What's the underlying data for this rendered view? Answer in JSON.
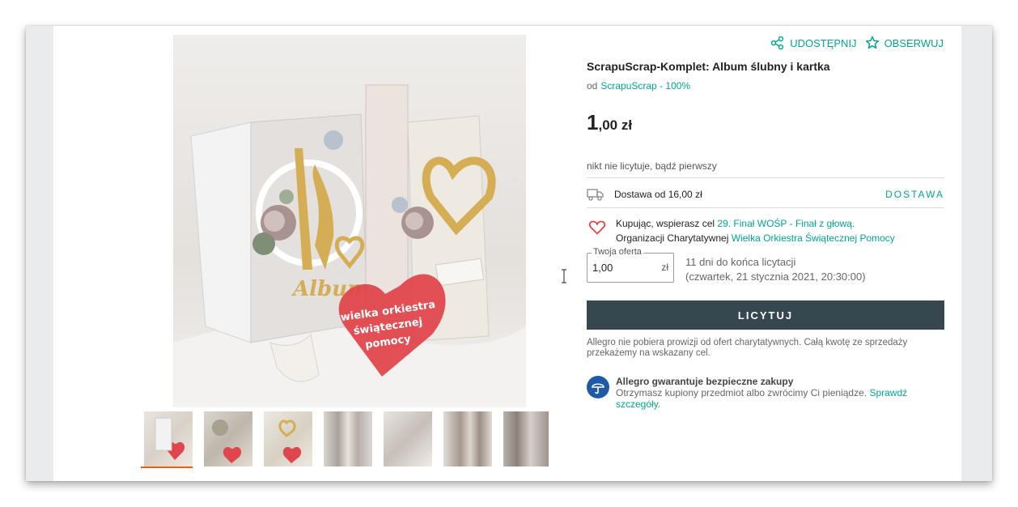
{
  "header": {
    "share_label": "UDOSTĘPNIJ",
    "watch_label": "OBSERWUJ"
  },
  "product": {
    "title": "ScrapuScrap-Komplet: Album ślubny i kartka",
    "seller_prefix": "od",
    "seller_name": "ScrapuScrap - 100%",
    "price_main": "1",
    "price_rest": ",00 zł",
    "bid_note": "nikt nie licytuje, bądź pierwszy"
  },
  "delivery": {
    "label": "Dostawa od 16,00 zł",
    "link": "DOSTAWA"
  },
  "charity": {
    "line1_prefix": "Kupując, wspierasz cel ",
    "line1_link": "29. Finał WOŚP - Finał z głową.",
    "line2_prefix": "Organizacji Charytatywnej ",
    "line2_link": "Wielka Orkiestra Świątecznej Pomocy"
  },
  "offer": {
    "label": "Twoja oferta",
    "value": "1,00",
    "currency": "zł",
    "ending_line1": "11 dni do końca licytacji",
    "ending_line2": "(czwartek, 21 stycznia 2021, 20:30:00)"
  },
  "bid_button": "LICYTUJ",
  "fee_note": "Allegro nie pobiera prowizji od ofert charytatywnych. Całą kwotę ze sprzedaży przekażemy na wskazany cel.",
  "guarantee": {
    "title": "Allegro gwarantuje bezpieczne zakupy",
    "text": "Otrzymasz kupiony przedmiot albo zwrócimy Ci pieniądze. ",
    "link": "Sprawdź szczegóły",
    "suffix": "."
  },
  "photo": {
    "album_text": "Album",
    "heart_line1": "wielka orkiestra",
    "heart_line2": "świątecznej",
    "heart_line3": "pomocy"
  },
  "thumbnails": [
    {
      "name": "thumb-1",
      "active": true
    },
    {
      "name": "thumb-2",
      "active": false
    },
    {
      "name": "thumb-3",
      "active": false
    },
    {
      "name": "thumb-4",
      "active": false
    },
    {
      "name": "thumb-5",
      "active": false
    },
    {
      "name": "thumb-6",
      "active": false
    },
    {
      "name": "thumb-7",
      "active": false
    }
  ],
  "colors": {
    "accent": "#00a790",
    "button": "#36474f",
    "heart": "#e0474c",
    "active_thumb": "#ff5a00"
  }
}
